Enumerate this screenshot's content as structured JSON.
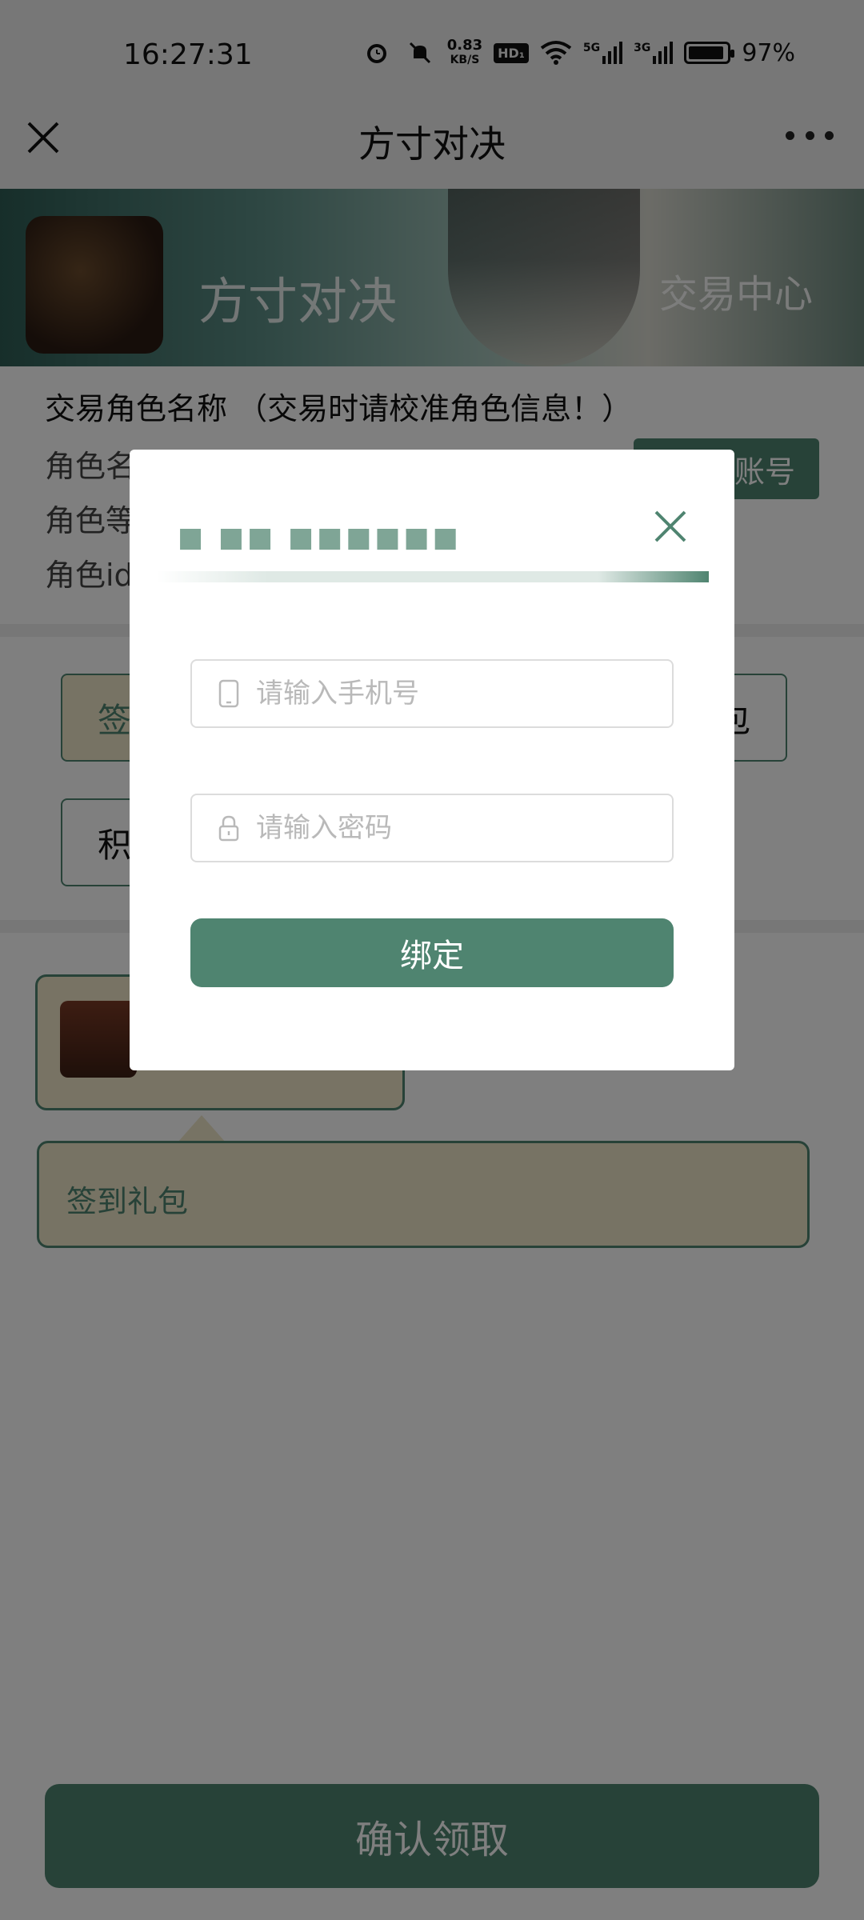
{
  "status_bar": {
    "time": "16:27:31",
    "net_speed_value": "0.83",
    "net_speed_unit": "KB/S",
    "hd_label": "HD₁",
    "signal1_label": "5G",
    "signal2_label": "3G",
    "battery_text": "97%",
    "battery_level": 0.97
  },
  "nav": {
    "title": "方寸对决"
  },
  "banner": {
    "game_name": "方寸对决",
    "trade_center": "交易中心"
  },
  "role_info": {
    "heading": "交易角色名称 （交易时请校准角色信息！）",
    "name_label": "角色名",
    "level_label": "角色等",
    "id_label": "角色id",
    "switch_button": "账号"
  },
  "tabs": {
    "checkin_tab": "签",
    "gift_tab": "包",
    "points_tab": "积"
  },
  "gift": {
    "tooltip_text": "签到礼包"
  },
  "confirm_button": "确认领取",
  "modal": {
    "title": "■ ■■   ■■■■■■",
    "phone_placeholder": "请输入手机号",
    "password_placeholder": "请输入密码",
    "bind_button": "绑定"
  },
  "colors": {
    "accent": "#4f8470",
    "card_bg": "#efe6c8",
    "overlay": "rgba(0,0,0,0.5)"
  }
}
